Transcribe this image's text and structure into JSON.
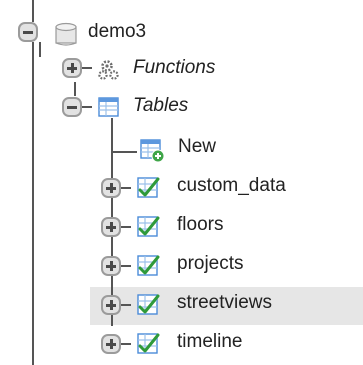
{
  "tree": {
    "database": {
      "label": "demo3",
      "icon": "database-icon",
      "expanded": true
    },
    "groups": [
      {
        "label": "Functions",
        "icon": "gears-icon",
        "expanded": false
      },
      {
        "label": "Tables",
        "icon": "tables-folder-icon",
        "expanded": true
      }
    ],
    "new_item": {
      "label": "New",
      "icon": "new-table-icon"
    },
    "tables": [
      {
        "label": "custom_data",
        "icon": "table-icon"
      },
      {
        "label": "floors",
        "icon": "table-icon"
      },
      {
        "label": "projects",
        "icon": "table-icon"
      },
      {
        "label": "streetviews",
        "icon": "table-icon",
        "highlighted": true
      },
      {
        "label": "timeline",
        "icon": "table-icon"
      }
    ]
  }
}
